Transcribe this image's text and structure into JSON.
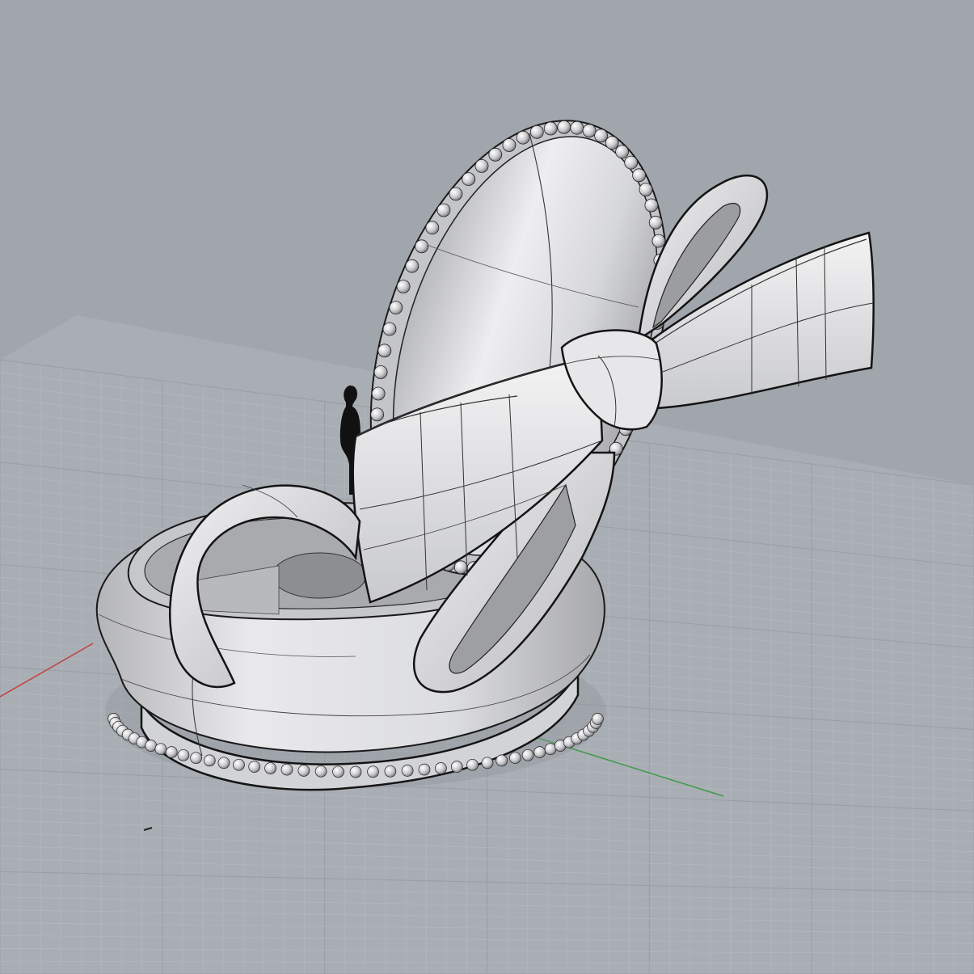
{
  "viewport": {
    "background": "#a1a6ad",
    "view": "perspective",
    "display_mode": "shaded"
  },
  "grid": {
    "visible": true,
    "minor_color": "#b3b7bd",
    "major_color": "#99a0a8",
    "x_axis_color": "#c0403a",
    "y_axis_color": "#3f9a48"
  },
  "model": {
    "type": "bow-pendant",
    "parts": [
      "oval-medallion",
      "bead-border",
      "ribbon-bow",
      "ring-base",
      "scale-figure"
    ],
    "surface_color": "#dedfe1",
    "edge_color": "#1a1a1a"
  },
  "scale_figure": {
    "visible": true,
    "color": "#111111"
  }
}
